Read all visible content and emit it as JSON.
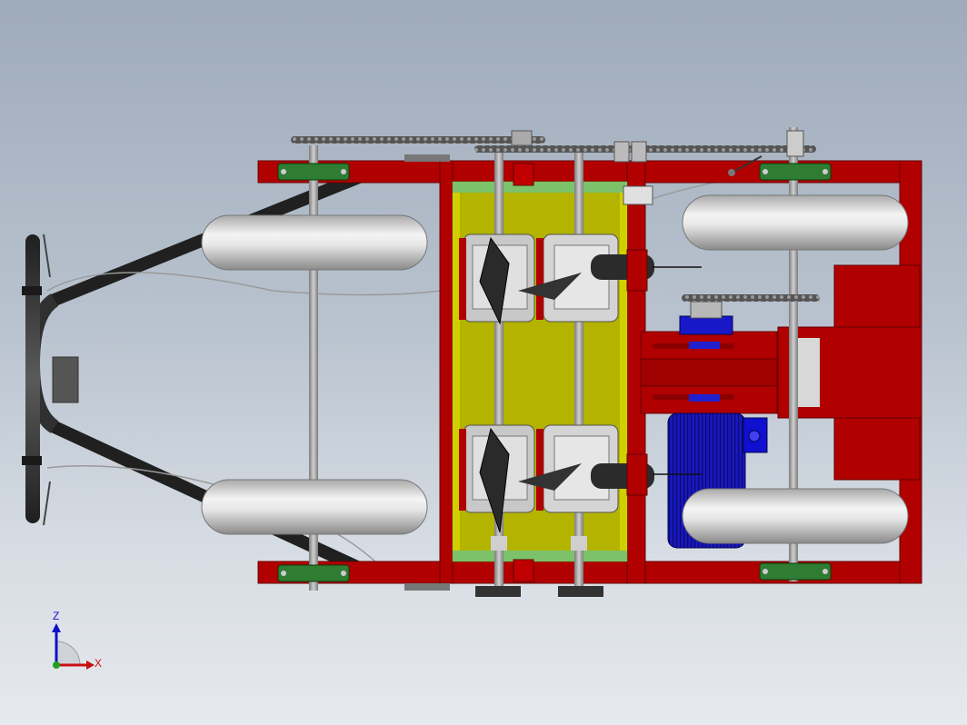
{
  "viewport": {
    "background_top": "#9eabbb",
    "background_bottom": "#e6e9ed"
  },
  "triad": {
    "z_label": "Z",
    "x_label": "X",
    "z_color": "#1010c8",
    "x_color": "#c81010"
  },
  "model": {
    "frame_color": "#b00000",
    "deck_color": "#b3b300",
    "motor_color": "#1010d0",
    "tire_color": "#d8d8d8",
    "bearing_color": "#2e7d32",
    "handle_color": "#3a3a3a"
  }
}
